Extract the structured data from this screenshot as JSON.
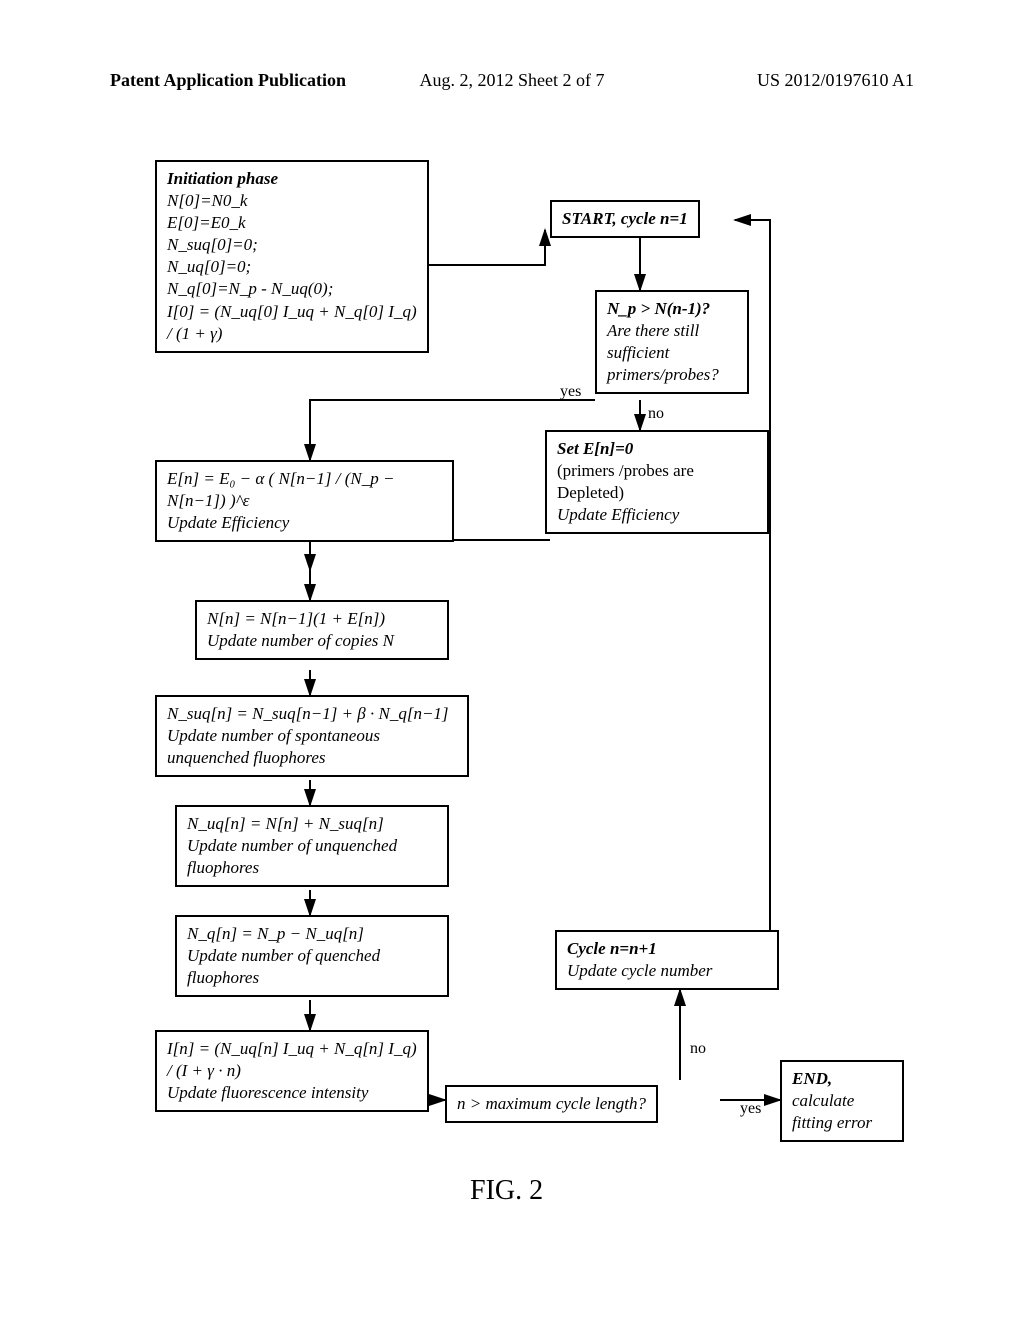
{
  "header": {
    "left": "Patent Application Publication",
    "center": "Aug. 2, 2012  Sheet 2 of 7",
    "right": "US 2012/0197610 A1"
  },
  "boxes": {
    "init": {
      "title": "Initiation phase",
      "l1": "N[0]=N0_k",
      "l2": "E[0]=E0_k",
      "l3": "N_suq[0]=0;",
      "l4": "N_uq[0]=0;",
      "l5": "N_q[0]=N_p - N_uq(0);",
      "l6": "I[0] = (N_uq[0] I_uq + N_q[0] I_q) / (1 + γ)"
    },
    "start": {
      "text": "START, cycle n=1"
    },
    "check": {
      "q": "N_p > N(n-1)?",
      "cap": "Are there still sufficient primers/probes?"
    },
    "setE0": {
      "l1": "Set E[n]=0",
      "l2": "(primers /probes are",
      "l3": "Depleted)",
      "cap": "Update Efficiency"
    },
    "eff": {
      "formula": "E[n] = E₀ − α ( N[n−1] / (N_p − N[n−1]) )^ε",
      "cap": "Update Efficiency"
    },
    "copies": {
      "formula": "N[n] = N[n−1](1 + E[n])",
      "cap": "Update number of copies N"
    },
    "suq": {
      "formula": "N_suq[n] = N_suq[n−1] + β · N_q[n−1]",
      "cap": "Update number of spontaneous unquenched fluophores"
    },
    "uq": {
      "formula": "N_uq[n] = N[n] + N_suq[n]",
      "cap": "Update number of unquenched fluophores"
    },
    "q": {
      "formula": "N_q[n] = N_p − N_uq[n]",
      "cap": "Update number of quenched fluophores"
    },
    "intensity": {
      "formula": "I[n] = (N_uq[n] I_uq + N_q[n] I_q) / (I + γ · n)",
      "cap": "Update fluorescence intensity"
    },
    "maxcycle": {
      "text": "n > maximum cycle length?"
    },
    "nextcycle": {
      "l1": "Cycle n=n+1",
      "cap": "Update cycle number"
    },
    "end": {
      "l1": "END,",
      "l2": "calculate",
      "l3": "fitting error"
    }
  },
  "labels": {
    "yes1": "yes",
    "no1": "no",
    "yes2": "yes",
    "no2": "no"
  },
  "figure_label": "FIG. 2"
}
